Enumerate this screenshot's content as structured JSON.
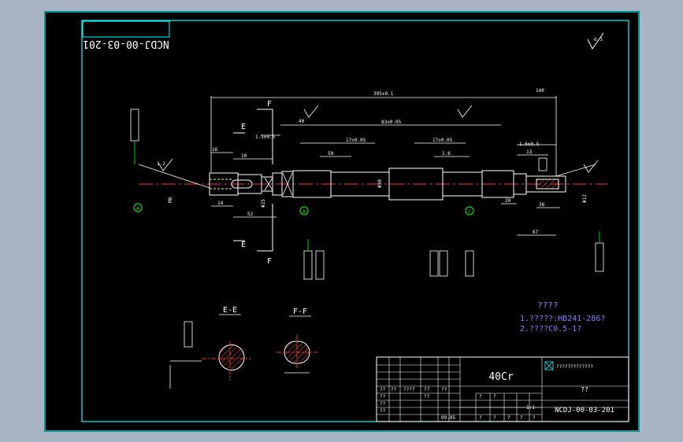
{
  "drawing": {
    "code_mirrored": "NCDJ-00-03-201",
    "roughness_symbol": "6.3",
    "section_marks": [
      "F",
      "E",
      "F",
      "E"
    ],
    "datum_labels": [
      "A",
      "B",
      "C"
    ],
    "section_titles": [
      "E-E",
      "F-F"
    ],
    "notes": {
      "title": "????",
      "line1": "1.?????:HB241-286?",
      "line2": "2.????C0.5-1?"
    },
    "title_block": {
      "material": "40Cr",
      "company": "?????????????",
      "part_name": "??",
      "drawing_no": "NCDJ-00-03-201",
      "scale": "1:1",
      "date": "09.05",
      "cells": [
        "??",
        "??",
        "????",
        "??",
        "??",
        "??",
        "??",
        "??",
        "?",
        "?",
        "?",
        "?",
        "?",
        "?",
        "??",
        "?"
      ]
    },
    "dimensions": [
      "395±0.1",
      "83±0.05",
      "17±0.05",
      "17±0.05",
      "1.5±0.5",
      "1.6±0.5",
      "140",
      "10",
      "16",
      "13",
      "14",
      "52",
      "40",
      "20",
      "36",
      "67",
      "50",
      "1.6",
      "1.2",
      "M8",
      "Φ12",
      "Φ25",
      "Φ30"
    ]
  }
}
